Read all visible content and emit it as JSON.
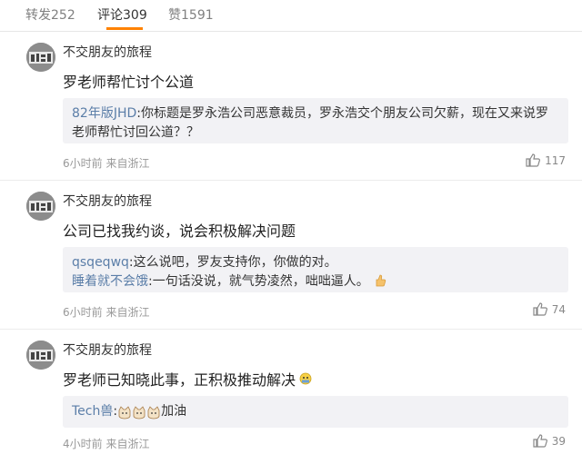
{
  "tabs": [
    {
      "label": "转发252"
    },
    {
      "label": "评论309"
    },
    {
      "label": "赞1591"
    }
  ],
  "comments": [
    {
      "username": "不交朋友的旅程",
      "text": "罗老师帮忙讨个公道",
      "replies": [
        {
          "name": "82年版JHD",
          "text": ":你标题是罗永浩公司恶意裁员，罗永浩交个朋友公司欠薪，现在又来说罗老师帮忙讨回公道？？"
        }
      ],
      "meta": "6小时前 来自浙江",
      "likes": "117"
    },
    {
      "username": "不交朋友的旅程",
      "text": "公司已找我约谈，说会积极解决问题",
      "replies": [
        {
          "name": "qsqeqwq",
          "text": ":这么说吧，罗友支持你，你做的对。"
        },
        {
          "name": "睡着就不会饿",
          "text": ":一句话没说，就气势凌然，咄咄逼人。"
        }
      ],
      "meta": "6小时前 来自浙江",
      "likes": "74"
    },
    {
      "username": "不交朋友的旅程",
      "text": "罗老师已知晓此事，正积极推动解决",
      "replies": [
        {
          "name": "Tech兽",
          "text": "加油"
        }
      ],
      "meta": "4小时前 来自浙江",
      "likes": "39"
    }
  ],
  "colors": {
    "accent": "#ff8200",
    "link": "#5b7ea8",
    "reply_bg": "#f2f2f5"
  },
  "icons": [
    "avatar",
    "thumbs-up-icon",
    "emoji-icon"
  ]
}
